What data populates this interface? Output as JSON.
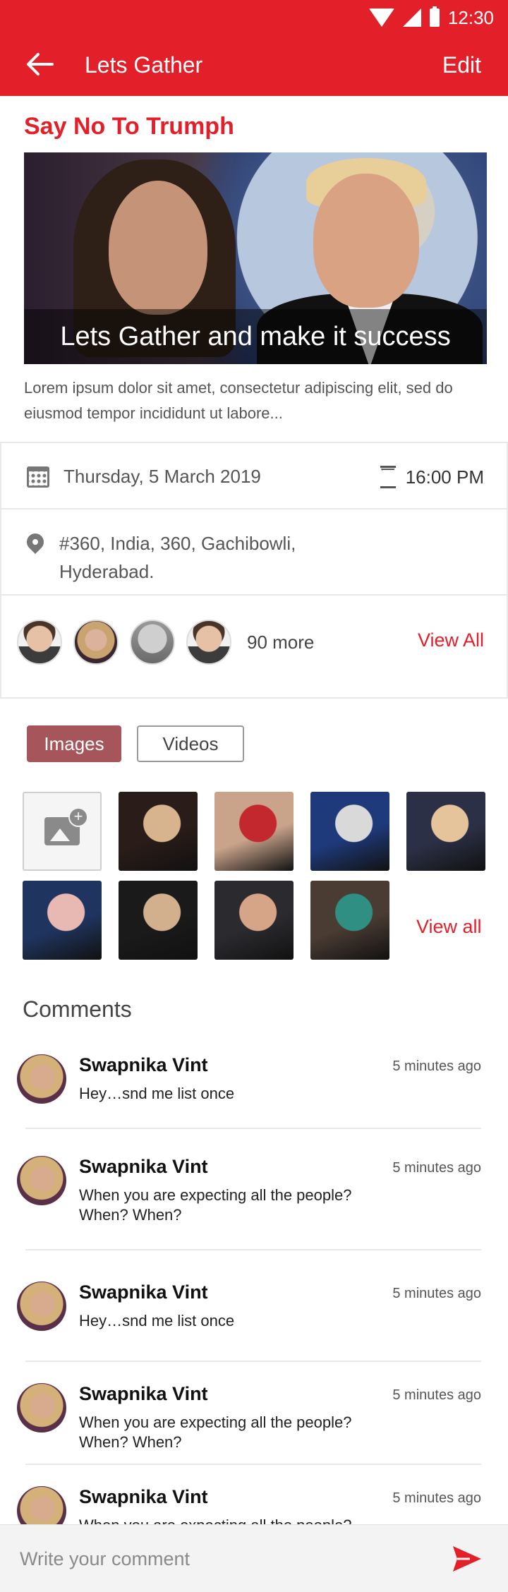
{
  "status_bar": {
    "time": "12:30"
  },
  "appbar": {
    "title": "Lets Gather",
    "edit_label": "Edit"
  },
  "event": {
    "title": "Say No To Trumph",
    "banner_caption": "Lets Gather and make it success",
    "description": "Lorem ipsum dolor sit amet, consectetur adipiscing elit, sed do eiusmod tempor incididunt ut labore...",
    "date": "Thursday, 5 March 2019",
    "time": "16:00 PM",
    "address": "#360, India, 360, Gachibowli, Hyderabad.",
    "attendees_more": "90 more",
    "view_all_label": "View All"
  },
  "media": {
    "tabs": [
      {
        "label": "Images",
        "active": true
      },
      {
        "label": "Videos",
        "active": false
      }
    ],
    "view_all_label": "View all",
    "thumbnails": [
      {
        "colors": [
          "#2a1c18",
          "#d7b38e"
        ]
      },
      {
        "colors": [
          "#c9a38a",
          "#c2282e"
        ]
      },
      {
        "colors": [
          "#1e3a7a",
          "#d9d9d9"
        ]
      },
      {
        "colors": [
          "#2c3046",
          "#e5c49b"
        ]
      },
      {
        "colors": [
          "#1f3560",
          "#e8b9b2"
        ]
      },
      {
        "colors": [
          "#1a1a1a",
          "#d3b08d"
        ]
      },
      {
        "colors": [
          "#2b2a2f",
          "#d6a486"
        ]
      },
      {
        "colors": [
          "#4a3b33",
          "#2f8f83"
        ]
      }
    ]
  },
  "comments": {
    "title": "Comments",
    "items": [
      {
        "name": "Swapnika Vint",
        "time": "5 minutes ago",
        "text": "Hey…snd me list once"
      },
      {
        "name": "Swapnika Vint",
        "time": "5 minutes ago",
        "text": "When you are expecting all the people? When? When?"
      },
      {
        "name": "Swapnika Vint",
        "time": "5 minutes ago",
        "text": "Hey…snd me list once"
      },
      {
        "name": "Swapnika Vint",
        "time": "5 minutes ago",
        "text": "When you are expecting all the people? When? When?"
      },
      {
        "name": "Swapnika Vint",
        "time": "5 minutes ago",
        "text": "When you are expecting all the people?"
      }
    ]
  },
  "composer": {
    "placeholder": "Write your comment"
  },
  "colors": {
    "accent": "#e3202a",
    "tab_active": "#a6565a"
  },
  "icons": [
    "back-arrow-icon",
    "calendar-icon",
    "hourglass-icon",
    "location-pin-icon",
    "add-image-icon",
    "send-icon"
  ]
}
